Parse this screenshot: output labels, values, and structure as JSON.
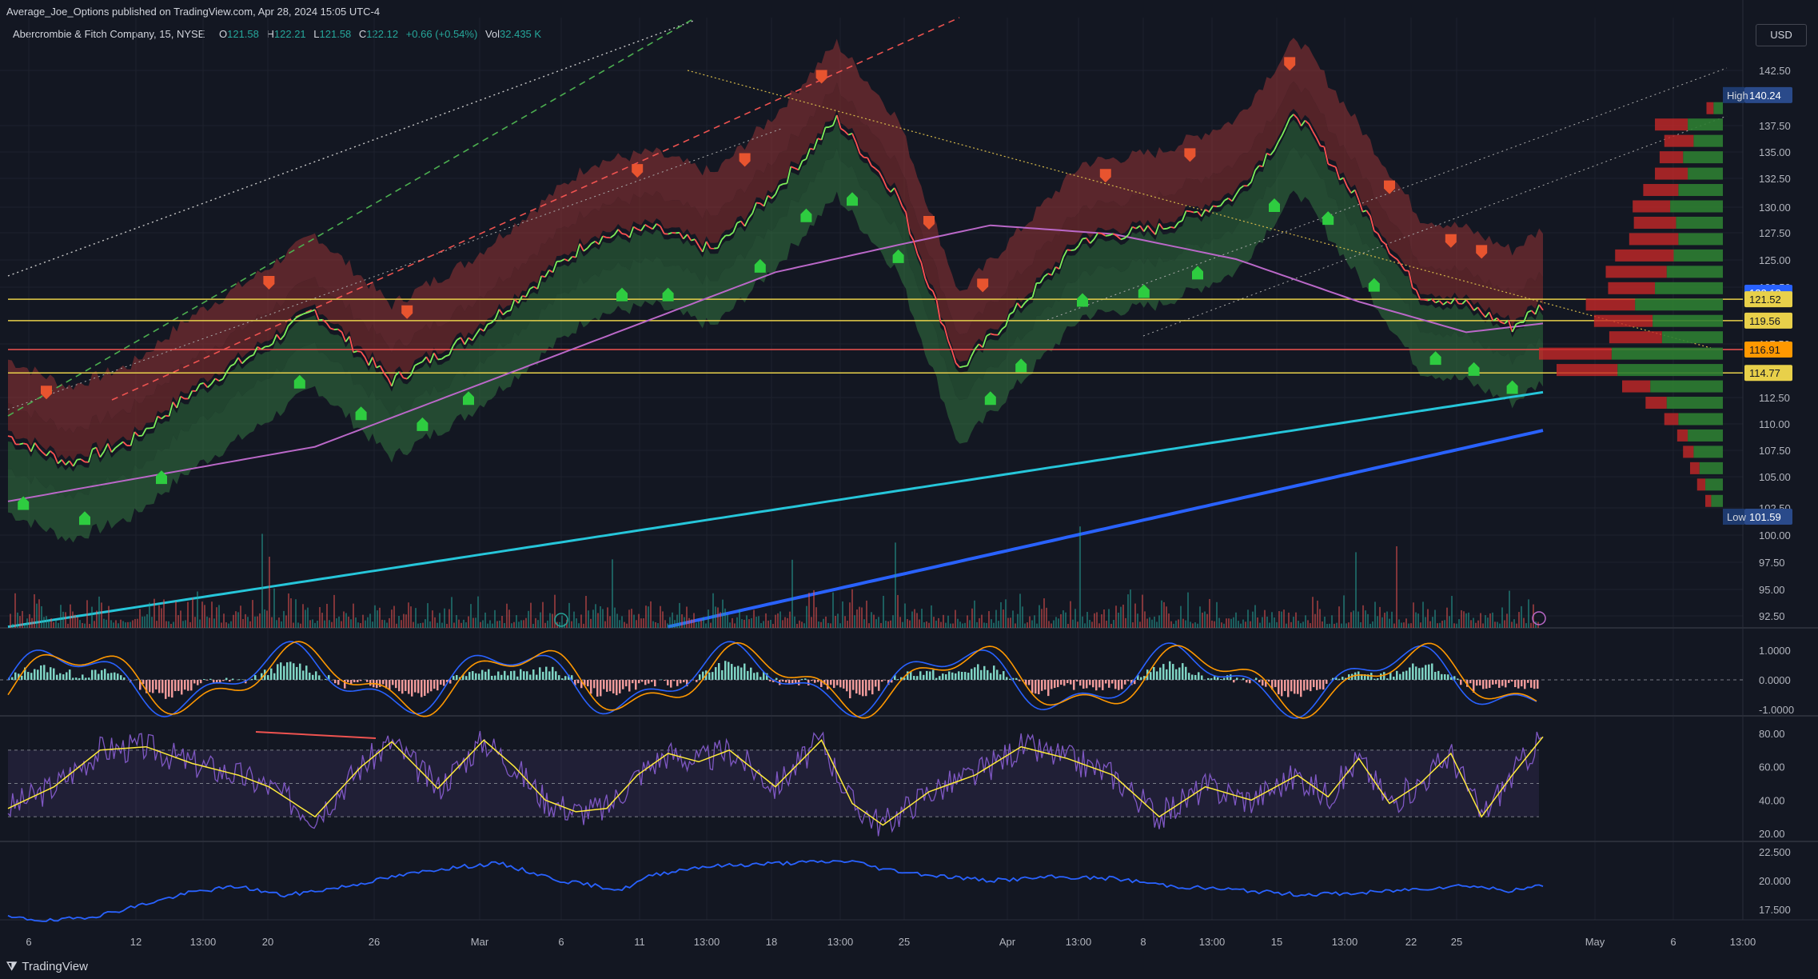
{
  "header": {
    "published": "Average_Joe_Options published on TradingView.com, Apr 28, 2024 15:05 UTC-4"
  },
  "legend": {
    "name": "Abercrombie & Fitch Company, 15, NYSE",
    "o_label": "O",
    "o": "121.58",
    "h_label": "H",
    "h": "122.21",
    "l_label": "L",
    "l": "121.58",
    "c_label": "C",
    "c": "122.12",
    "change": "+0.66 (+0.54%)",
    "vol_label": "Vol",
    "vol": "32.435 K"
  },
  "currency_button": "USD",
  "footer": {
    "brand": "TradingView"
  },
  "colors": {
    "bg": "#131722",
    "up": "#26a69a",
    "down": "#ef5350",
    "ma200": "#26c6da",
    "ma_long": "#2962ff",
    "ma_mid": "#ba68c8",
    "rsi": "#7e57c2",
    "rsi_sig": "#ffeb3b"
  },
  "chart_data": [
    {
      "type": "line",
      "panel": "price",
      "x_ticks": [
        "6",
        "12",
        "13:00",
        "20",
        "26",
        "Mar",
        "6",
        "11",
        "13:00",
        "18",
        "13:00",
        "25",
        "Apr",
        "13:00",
        "8",
        "13:00",
        "15",
        "13:00",
        "22",
        "25",
        "May",
        "6",
        "13:00"
      ],
      "y_ticks": [
        "142.50",
        "137.50",
        "135.00",
        "132.50",
        "130.00",
        "127.50",
        "125.00",
        "122.50",
        "117.50",
        "112.50",
        "110.00",
        "107.50",
        "105.00",
        "102.50",
        "100.00",
        "97.50",
        "95.00",
        "92.50"
      ],
      "ylim": [
        91.5,
        145.5
      ],
      "series": [
        {
          "x": [
            0,
            4,
            8,
            12,
            16,
            20,
            25,
            30,
            34,
            38,
            42,
            46,
            50,
            54,
            58,
            62,
            66,
            70,
            75,
            80,
            84,
            88,
            92,
            95,
            98,
            100
          ],
          "values": [
            109,
            106.5,
            108.5,
            113,
            116.5,
            120.5,
            114,
            118,
            122.5,
            127,
            128,
            126,
            131.5,
            138,
            131,
            115,
            121,
            127,
            128,
            131,
            138.5,
            130.5,
            122,
            121,
            119,
            121
          ],
          "color": "#9ae66e"
        },
        {
          "x": [
            0,
            100
          ],
          "values": [
            91.5,
            113
          ],
          "color": "#26c6da"
        },
        {
          "x": [
            43,
            100
          ],
          "values": [
            91.5,
            109.5
          ],
          "color": "#2962ff"
        },
        {
          "x": [
            0,
            20,
            35,
            50,
            58,
            64,
            72,
            80,
            88,
            95,
            100
          ],
          "values": [
            103,
            108,
            116,
            124,
            126.5,
            128.3,
            127.5,
            125.2,
            121.3,
            118.5,
            119.3
          ],
          "color": "#ba68c8"
        }
      ],
      "price_labels": [
        {
          "text": "High",
          "value": "140.24"
        },
        {
          "value": "122.12"
        },
        {
          "value": "121.52"
        },
        {
          "value": "119.56"
        },
        {
          "value": "116.91"
        },
        {
          "value": "114.77"
        },
        {
          "text": "Low",
          "value": "101.59"
        }
      ],
      "horizontal_levels": [
        121.52,
        119.56,
        116.91,
        114.77
      ],
      "volume_profile": {
        "levels": [
          139,
          137.5,
          136,
          134.5,
          133,
          131.5,
          130,
          128.5,
          127,
          125.5,
          124,
          122.5,
          121,
          119.5,
          118,
          116.5,
          115,
          113.5,
          112,
          110.5,
          109,
          107.5,
          106,
          104.5,
          103
        ],
        "buy": [
          8,
          30,
          25,
          34,
          30,
          38,
          45,
          40,
          38,
          42,
          48,
          58,
          75,
          60,
          52,
          95,
          90,
          62,
          48,
          38,
          30,
          25,
          20,
          15,
          10
        ],
        "sell": [
          6,
          28,
          25,
          20,
          28,
          30,
          32,
          36,
          42,
          50,
          52,
          40,
          42,
          50,
          45,
          62,
          52,
          24,
          18,
          12,
          9,
          9,
          8,
          7,
          5
        ]
      }
    },
    {
      "type": "line",
      "panel": "oscillator",
      "y_ticks": [
        "1.0000",
        "0.0000",
        "-1.0000"
      ],
      "ylim": [
        -1.3,
        1.4
      ]
    },
    {
      "type": "line",
      "panel": "rsi",
      "y_ticks": [
        "80.00",
        "60.00",
        "40.00",
        "20.00"
      ],
      "ylim": [
        17,
        83
      ],
      "x": [
        0,
        3,
        6,
        9,
        12,
        15,
        17,
        20,
        23,
        25,
        28,
        31,
        33,
        35,
        37,
        39,
        41,
        43,
        45,
        47,
        50,
        53,
        55,
        57,
        60,
        63,
        66,
        69,
        72,
        75,
        78,
        81,
        84,
        86,
        88,
        90,
        92,
        94,
        96,
        98,
        100
      ],
      "values": [
        35,
        48,
        70,
        72,
        62,
        55,
        48,
        30,
        60,
        75,
        47,
        76,
        60,
        40,
        33,
        35,
        55,
        68,
        63,
        70,
        48,
        76,
        38,
        25,
        45,
        55,
        72,
        65,
        55,
        30,
        48,
        40,
        55,
        42,
        65,
        38,
        50,
        68,
        30,
        55,
        78
      ],
      "rsi_upper": 70,
      "rsi_mid": 50,
      "rsi_lower": 30
    },
    {
      "type": "line",
      "panel": "lower",
      "y_ticks": [
        "22.500",
        "20.000",
        "17.500"
      ],
      "ylim": [
        15.5,
        23
      ],
      "x": [
        0,
        3,
        6,
        9,
        12,
        15,
        18,
        22,
        25,
        28,
        32,
        36,
        40,
        42,
        45,
        50,
        55,
        57,
        60,
        64,
        68,
        72,
        76,
        80,
        84,
        88,
        92,
        95,
        98,
        100
      ],
      "values": [
        16.8,
        16.5,
        17,
        18,
        19,
        19.5,
        18.7,
        19.5,
        20.3,
        21,
        21.5,
        20,
        19.2,
        20.5,
        21.2,
        21.5,
        21.7,
        21,
        20.5,
        20,
        20.3,
        20.2,
        19.5,
        19.2,
        18.8,
        18.9,
        19.3,
        19.6,
        19.1,
        19.6
      ]
    }
  ]
}
